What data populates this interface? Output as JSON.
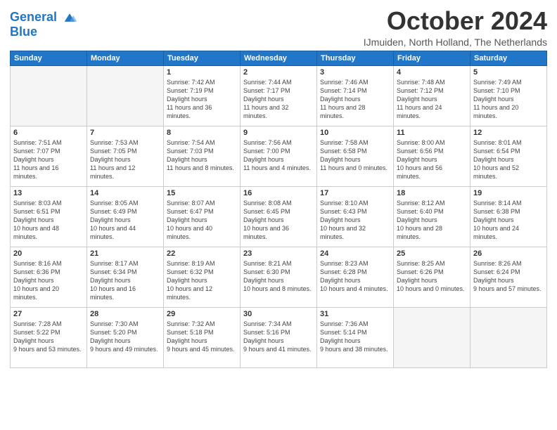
{
  "header": {
    "logo_line1": "General",
    "logo_line2": "Blue",
    "month_title": "October 2024",
    "location": "IJmuiden, North Holland, The Netherlands"
  },
  "days_of_week": [
    "Sunday",
    "Monday",
    "Tuesday",
    "Wednesday",
    "Thursday",
    "Friday",
    "Saturday"
  ],
  "weeks": [
    [
      {
        "day": "",
        "empty": true
      },
      {
        "day": "",
        "empty": true
      },
      {
        "day": "1",
        "sunrise": "7:42 AM",
        "sunset": "7:19 PM",
        "daylight": "11 hours and 36 minutes."
      },
      {
        "day": "2",
        "sunrise": "7:44 AM",
        "sunset": "7:17 PM",
        "daylight": "11 hours and 32 minutes."
      },
      {
        "day": "3",
        "sunrise": "7:46 AM",
        "sunset": "7:14 PM",
        "daylight": "11 hours and 28 minutes."
      },
      {
        "day": "4",
        "sunrise": "7:48 AM",
        "sunset": "7:12 PM",
        "daylight": "11 hours and 24 minutes."
      },
      {
        "day": "5",
        "sunrise": "7:49 AM",
        "sunset": "7:10 PM",
        "daylight": "11 hours and 20 minutes."
      }
    ],
    [
      {
        "day": "6",
        "sunrise": "7:51 AM",
        "sunset": "7:07 PM",
        "daylight": "11 hours and 16 minutes."
      },
      {
        "day": "7",
        "sunrise": "7:53 AM",
        "sunset": "7:05 PM",
        "daylight": "11 hours and 12 minutes."
      },
      {
        "day": "8",
        "sunrise": "7:54 AM",
        "sunset": "7:03 PM",
        "daylight": "11 hours and 8 minutes."
      },
      {
        "day": "9",
        "sunrise": "7:56 AM",
        "sunset": "7:00 PM",
        "daylight": "11 hours and 4 minutes."
      },
      {
        "day": "10",
        "sunrise": "7:58 AM",
        "sunset": "6:58 PM",
        "daylight": "11 hours and 0 minutes."
      },
      {
        "day": "11",
        "sunrise": "8:00 AM",
        "sunset": "6:56 PM",
        "daylight": "10 hours and 56 minutes."
      },
      {
        "day": "12",
        "sunrise": "8:01 AM",
        "sunset": "6:54 PM",
        "daylight": "10 hours and 52 minutes."
      }
    ],
    [
      {
        "day": "13",
        "sunrise": "8:03 AM",
        "sunset": "6:51 PM",
        "daylight": "10 hours and 48 minutes."
      },
      {
        "day": "14",
        "sunrise": "8:05 AM",
        "sunset": "6:49 PM",
        "daylight": "10 hours and 44 minutes."
      },
      {
        "day": "15",
        "sunrise": "8:07 AM",
        "sunset": "6:47 PM",
        "daylight": "10 hours and 40 minutes."
      },
      {
        "day": "16",
        "sunrise": "8:08 AM",
        "sunset": "6:45 PM",
        "daylight": "10 hours and 36 minutes."
      },
      {
        "day": "17",
        "sunrise": "8:10 AM",
        "sunset": "6:43 PM",
        "daylight": "10 hours and 32 minutes."
      },
      {
        "day": "18",
        "sunrise": "8:12 AM",
        "sunset": "6:40 PM",
        "daylight": "10 hours and 28 minutes."
      },
      {
        "day": "19",
        "sunrise": "8:14 AM",
        "sunset": "6:38 PM",
        "daylight": "10 hours and 24 minutes."
      }
    ],
    [
      {
        "day": "20",
        "sunrise": "8:16 AM",
        "sunset": "6:36 PM",
        "daylight": "10 hours and 20 minutes."
      },
      {
        "day": "21",
        "sunrise": "8:17 AM",
        "sunset": "6:34 PM",
        "daylight": "10 hours and 16 minutes."
      },
      {
        "day": "22",
        "sunrise": "8:19 AM",
        "sunset": "6:32 PM",
        "daylight": "10 hours and 12 minutes."
      },
      {
        "day": "23",
        "sunrise": "8:21 AM",
        "sunset": "6:30 PM",
        "daylight": "10 hours and 8 minutes."
      },
      {
        "day": "24",
        "sunrise": "8:23 AM",
        "sunset": "6:28 PM",
        "daylight": "10 hours and 4 minutes."
      },
      {
        "day": "25",
        "sunrise": "8:25 AM",
        "sunset": "6:26 PM",
        "daylight": "10 hours and 0 minutes."
      },
      {
        "day": "26",
        "sunrise": "8:26 AM",
        "sunset": "6:24 PM",
        "daylight": "9 hours and 57 minutes."
      }
    ],
    [
      {
        "day": "27",
        "sunrise": "7:28 AM",
        "sunset": "5:22 PM",
        "daylight": "9 hours and 53 minutes."
      },
      {
        "day": "28",
        "sunrise": "7:30 AM",
        "sunset": "5:20 PM",
        "daylight": "9 hours and 49 minutes."
      },
      {
        "day": "29",
        "sunrise": "7:32 AM",
        "sunset": "5:18 PM",
        "daylight": "9 hours and 45 minutes."
      },
      {
        "day": "30",
        "sunrise": "7:34 AM",
        "sunset": "5:16 PM",
        "daylight": "9 hours and 41 minutes."
      },
      {
        "day": "31",
        "sunrise": "7:36 AM",
        "sunset": "5:14 PM",
        "daylight": "9 hours and 38 minutes."
      },
      {
        "day": "",
        "empty": true
      },
      {
        "day": "",
        "empty": true
      }
    ]
  ]
}
